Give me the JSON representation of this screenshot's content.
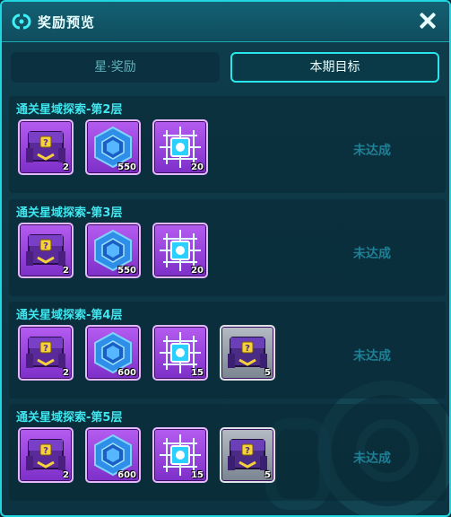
{
  "header": {
    "title": "奖励预览"
  },
  "tabs": [
    {
      "label": "星·奖励",
      "active": false
    },
    {
      "label": "本期目标",
      "active": true
    }
  ],
  "sections": [
    {
      "title": "通关星域探索-第2层",
      "status": "未达成",
      "items": [
        {
          "icon": "purple-treasure-chest-icon",
          "count": "2"
        },
        {
          "icon": "blue-crystal-icon",
          "count": "550"
        },
        {
          "icon": "circuit-chip-icon",
          "count": "20"
        }
      ]
    },
    {
      "title": "通关星域探索-第3层",
      "status": "未达成",
      "items": [
        {
          "icon": "purple-treasure-chest-icon",
          "count": "2"
        },
        {
          "icon": "blue-crystal-icon",
          "count": "550"
        },
        {
          "icon": "circuit-chip-icon",
          "count": "20"
        }
      ]
    },
    {
      "title": "通关星域探索-第4层",
      "status": "未达成",
      "items": [
        {
          "icon": "purple-treasure-chest-icon",
          "count": "2"
        },
        {
          "icon": "blue-crystal-icon",
          "count": "600"
        },
        {
          "icon": "circuit-chip-icon",
          "count": "15"
        },
        {
          "icon": "gray-treasure-chest-icon",
          "count": "5"
        }
      ]
    },
    {
      "title": "通关星域探索-第5层",
      "status": "未达成",
      "items": [
        {
          "icon": "purple-treasure-chest-icon",
          "count": "2"
        },
        {
          "icon": "blue-crystal-icon",
          "count": "600"
        },
        {
          "icon": "circuit-chip-icon",
          "count": "15"
        },
        {
          "icon": "gray-treasure-chest-icon",
          "count": "5"
        }
      ]
    }
  ],
  "colors": {
    "accent": "#1fd6df",
    "section_title": "#3fe6ee",
    "status_text": "#1f7f95",
    "rare_frame": "#9b45e0",
    "common_frame": "#9aa2ad"
  }
}
